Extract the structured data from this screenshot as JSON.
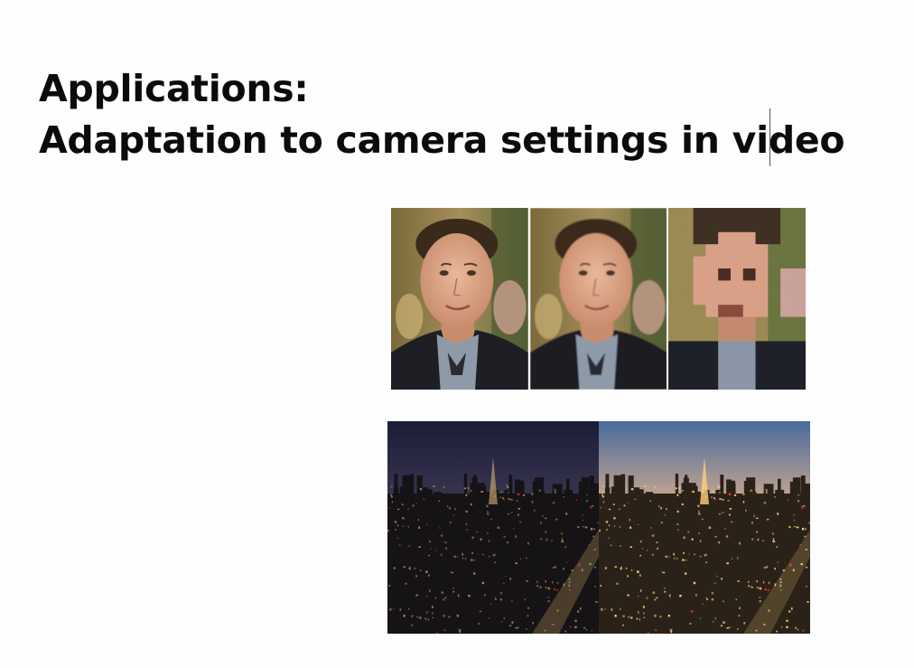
{
  "slide": {
    "title_line1": "Applications:",
    "title_line2": "Adaptation to camera settings in video"
  },
  "figures": {
    "faces": {
      "panels": [
        "original",
        "slightly-blurred",
        "pixelated"
      ]
    },
    "city": {
      "panels": [
        "dark-exposure",
        "bright-exposure"
      ]
    }
  },
  "colors": {
    "background": "#fefefe",
    "title_text": "#0b0b0b"
  }
}
